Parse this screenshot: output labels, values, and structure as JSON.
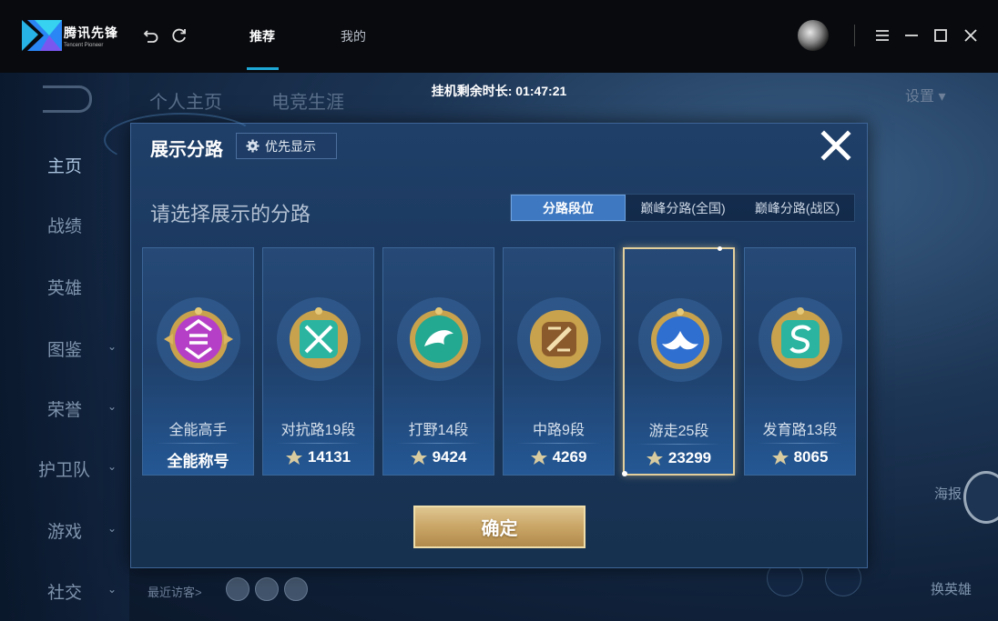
{
  "app": {
    "name_cn": "腾讯先锋",
    "name_en": "Tencent Pioneer"
  },
  "nav": {
    "tabs": [
      {
        "label": "推荐"
      },
      {
        "label": "我的"
      }
    ],
    "active_tab": "推荐"
  },
  "session": {
    "afk_timer": "挂机剩余时长: 01:47:21"
  },
  "game": {
    "sidebar": [
      "主页",
      "战绩",
      "英雄",
      "图鉴",
      "荣誉",
      "护卫队",
      "游戏",
      "社交"
    ],
    "profile_tabs": [
      "个人主页",
      "电竞生涯"
    ],
    "settings_label": "设置",
    "recent_visitors": "最近访客>",
    "poster_label": "海报",
    "hero_label": "换英雄"
  },
  "modal": {
    "title": "展示分路",
    "priority_button": "优先显示",
    "subtitle": "请选择展示的分路",
    "segments": [
      {
        "label": "分路段位",
        "active": true
      },
      {
        "label": "巅峰分路(全国)",
        "active": false
      },
      {
        "label": "巅峰分路(战区)",
        "active": false
      }
    ],
    "cards": [
      {
        "name": "全能高手",
        "value": "全能称号",
        "emblem": "purple-emblem",
        "selected": false
      },
      {
        "name": "对抗路19段",
        "value": "14131",
        "emblem": "clash-emblem",
        "selected": false
      },
      {
        "name": "打野14段",
        "value": "9424",
        "emblem": "jungle-emblem",
        "selected": false
      },
      {
        "name": "中路9段",
        "value": "4269",
        "emblem": "mid-emblem",
        "selected": false
      },
      {
        "name": "游走25段",
        "value": "23299",
        "emblem": "roam-emblem",
        "selected": true
      },
      {
        "name": "发育路13段",
        "value": "8065",
        "emblem": "farm-emblem",
        "selected": false
      }
    ],
    "confirm_button": "确定"
  },
  "colors": {
    "accent": "#1ea8d6",
    "segment_active": "#3d78c1",
    "gold": "#c9a566",
    "selected_border": "#e2cf9c"
  }
}
